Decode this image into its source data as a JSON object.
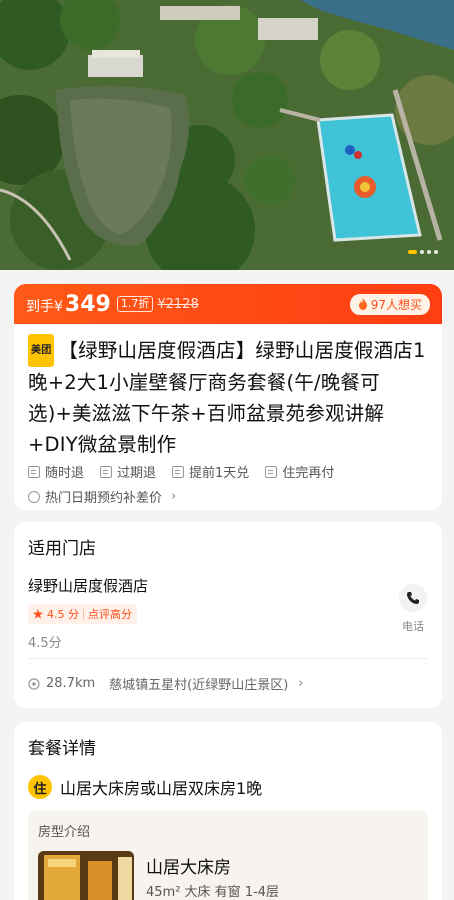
{
  "colors": {
    "accent": "#ff4d1a",
    "brand_yellow": "#ffc300",
    "page_bg": "#f4f4f4"
  },
  "hero": {
    "carousel_dots": 4,
    "active_dot": 1
  },
  "price": {
    "prefix": "到手¥",
    "value": "349",
    "discount": "1.7折",
    "original": "¥2128",
    "want_count": "97人想买"
  },
  "product": {
    "brand_badge": "美团",
    "title": "【绿野山居度假酒店】绿野山居度假酒店1晚+2大1小崖壁餐厅商务套餐(午/晚餐可选)+美滋滋下午茶+百师盆景苑参观讲解+DIY微盆景制作",
    "tags": [
      "随时退",
      "过期退",
      "提前1天兑",
      "住完再付"
    ],
    "notice": "热门日期预约补差价",
    "notice_icon": "info-circle-icon"
  },
  "store": {
    "section_title": "适用门店",
    "name": "绿野山居度假酒店",
    "rating": "4.5 分",
    "rating_tag": "点评高分",
    "score_text": "4.5分",
    "phone_label": "电话",
    "distance": "28.7km",
    "address": "慈城镇五星村(近绿野山庄景区)"
  },
  "package": {
    "section_title": "套餐详情",
    "stay_badge": "住",
    "stay_text": "山居大床房或山居双床房1晚",
    "roomtype_label": "房型介绍",
    "room_name": "山居大床房",
    "room_info": "45m² 大床 有窗 1-4层"
  }
}
